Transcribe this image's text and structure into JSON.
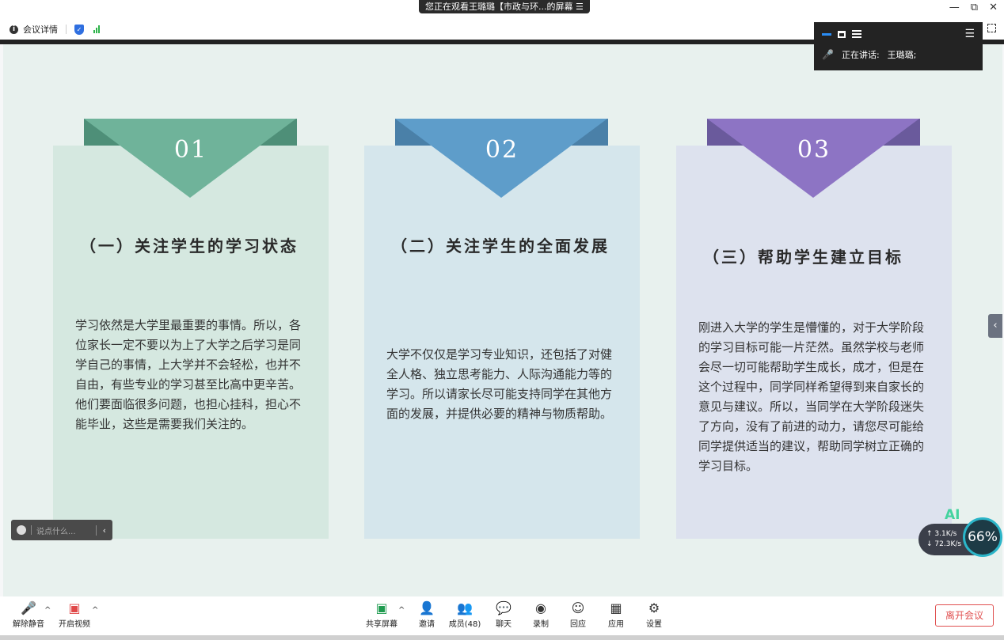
{
  "share_banner": "您正在观看王璐璐【市政与环...的屏幕 ☰",
  "window_controls": [
    "—",
    "⧉",
    "✕"
  ],
  "info_bar": {
    "meeting_details": "会议详情"
  },
  "speaker_panel": {
    "speaking_label": "正在讲话:",
    "speaker_name": "王璐璐;"
  },
  "cards": [
    {
      "number": "01",
      "title": "（一）关注学生的学习状态",
      "body": "学习依然是大学里最重要的事情。所以，各位家长一定不要以为上了大学之后学习是同学自己的事情，上大学并不会轻松，也并不自由，有些专业的学习甚至比高中更辛苦。他们要面临很多问题，也担心挂科，担心不能毕业，这些是需要我们关注的。"
    },
    {
      "number": "02",
      "title": "（二）关注学生的全面发展",
      "body": "大学不仅仅是学习专业知识，还包括了对健全人格、独立思考能力、人际沟通能力等的学习。所以请家长尽可能支持同学在其他方面的发展，并提供必要的精神与物质帮助。"
    },
    {
      "number": "03",
      "title": "（三）帮助学生建立目标",
      "body": "刚进入大学的学生是懵懂的，对于大学阶段的学习目标可能一片茫然。虽然学校与老师会尽一切可能帮助学生成长，成才，但是在这个过程中，同学同样希望得到来自家长的意见与建议。所以，当同学在大学阶段迷失了方向，没有了前进的动力，请您尽可能给同学提供适当的建议，帮助同学树立正确的学习目标。"
    }
  ],
  "chat_input": {
    "placeholder": "说点什么..."
  },
  "network": {
    "ai": "AI",
    "upload": "↑ 3.1K/s",
    "download": "↓ 72.3K/s",
    "percent": "66%"
  },
  "toolbar": {
    "unmute": "解除静音",
    "start_video": "开启视频",
    "share_screen": "共享屏幕",
    "invite": "邀请",
    "members": "成员(48)",
    "chat": "聊天",
    "record": "录制",
    "reactions": "回应",
    "apps": "应用",
    "settings": "设置",
    "leave": "离开会议"
  },
  "colors": {
    "card1": "#d5e8e0",
    "card2": "#d5e6ec",
    "card3": "#dde2ee",
    "accent1": "#6fb39a",
    "accent2": "#5e9dca",
    "accent3": "#8d74c4",
    "leave": "#e05050"
  }
}
